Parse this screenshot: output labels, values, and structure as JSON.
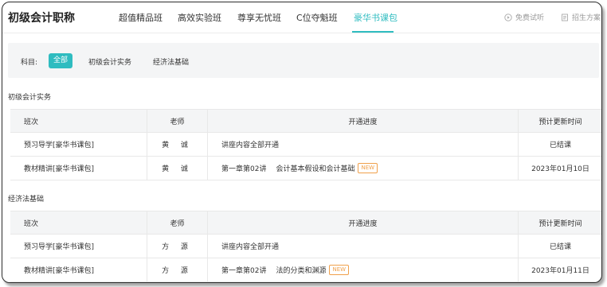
{
  "header": {
    "title": "初级会计职称",
    "tabs": [
      {
        "label": "超值精品班"
      },
      {
        "label": "高效实验班"
      },
      {
        "label": "尊享无忧班"
      },
      {
        "label": "C位夺魁班"
      },
      {
        "label": "豪华书课包",
        "active": true
      }
    ],
    "free_trial": "免费试听",
    "admissions": "招生方案"
  },
  "filter": {
    "label": "科目:",
    "options": [
      "全部",
      "初级会计实务",
      "经济法基础"
    ],
    "selected": "全部"
  },
  "columns": [
    "班次",
    "老师",
    "开通进度",
    "预计更新时间"
  ],
  "sections": [
    {
      "title": "初级会计实务",
      "rows": [
        {
          "class": "预习导学[豪华书课包]",
          "teacher": "黄 诚",
          "progress": "讲座内容全部开通",
          "updated": "已结课"
        },
        {
          "class": "教材精讲[豪华书课包]",
          "teacher": "黄 诚",
          "progress_a": "第一章第02讲",
          "progress_b": "会计基本假设和会计基础",
          "badge": "NEW",
          "updated": "2023年01月10日"
        }
      ]
    },
    {
      "title": "经济法基础",
      "rows": [
        {
          "class": "预习导学[豪华书课包]",
          "teacher": "方 源",
          "progress": "讲座内容全部开通",
          "updated": "已结课"
        },
        {
          "class": "教材精讲[豪华书课包]",
          "teacher": "方 源",
          "progress_a": "第一章第02讲",
          "progress_b": "法的分类和渊源",
          "badge": "NEW",
          "updated": "2023年01月11日"
        }
      ]
    }
  ],
  "colors": {
    "accent": "#2fbcc0",
    "badge": "#f0a04b"
  }
}
